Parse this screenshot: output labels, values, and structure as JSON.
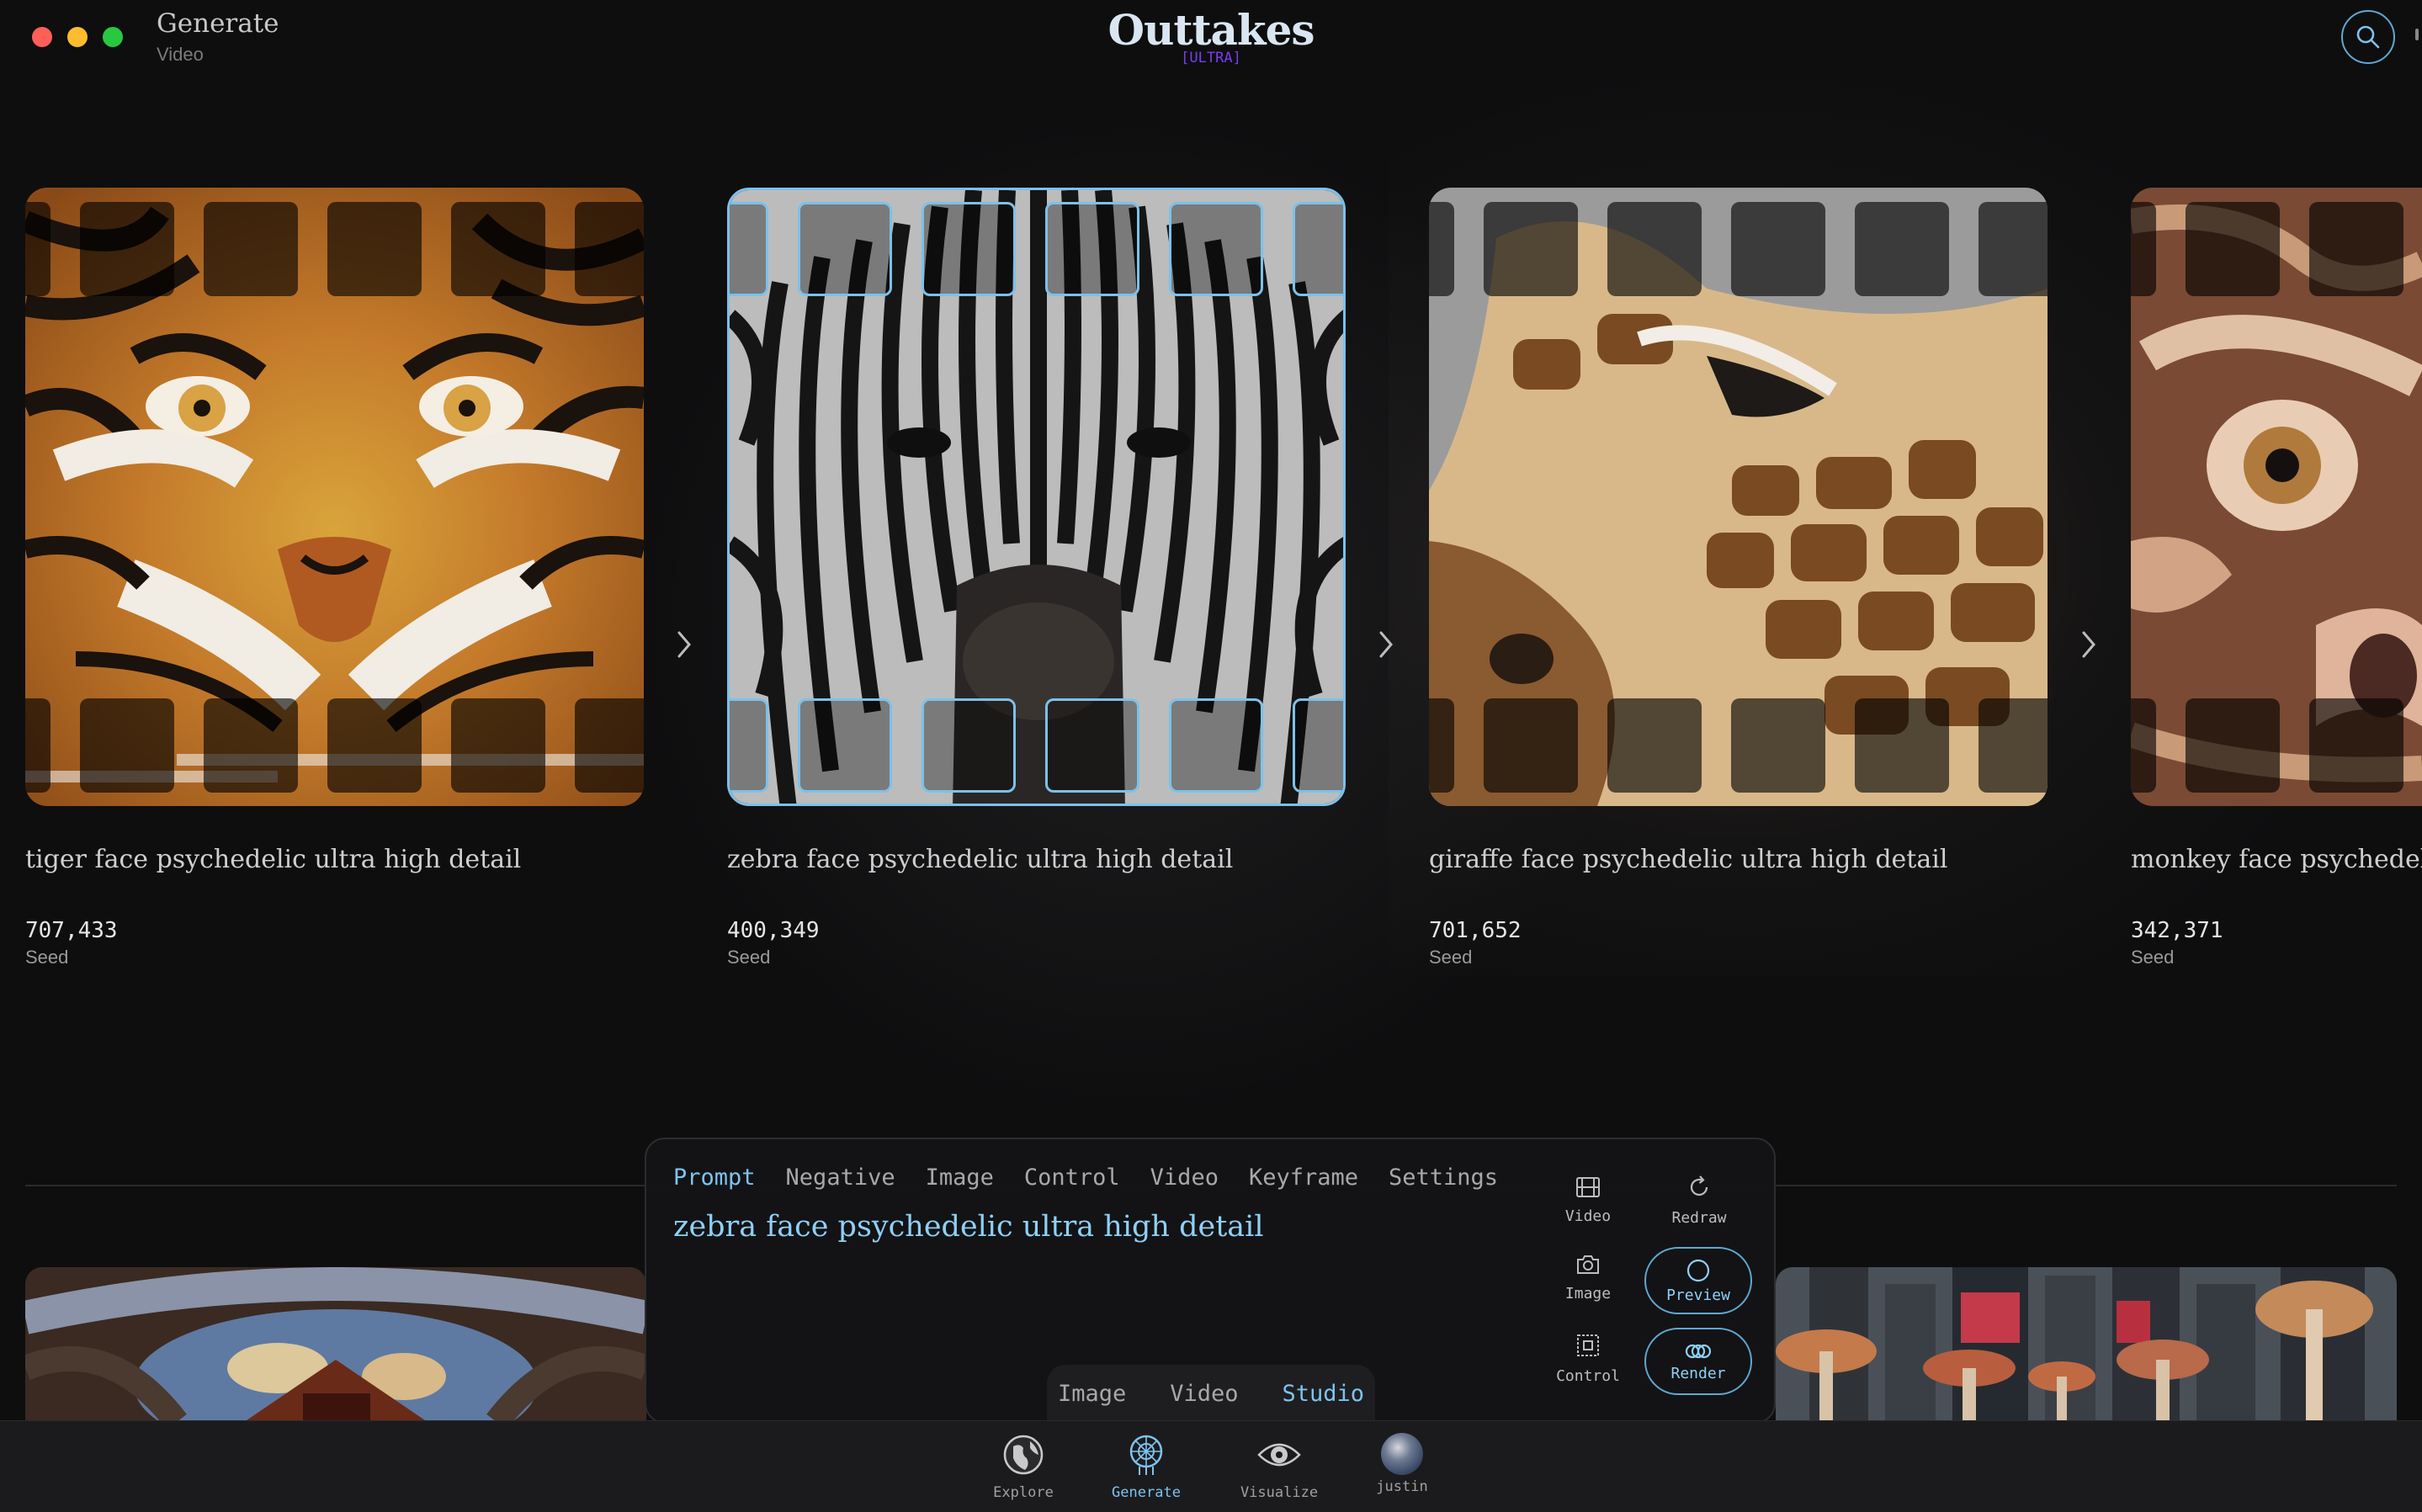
{
  "window": {
    "title": "Generate",
    "subtitle": "Video"
  },
  "brand": {
    "name": "Outtakes",
    "tier": "[ULTRA]",
    "accent": "#7ec3ef",
    "tier_color": "#7a3cf2"
  },
  "cards": [
    {
      "caption": "tiger face psychedelic ultra high detail",
      "seed": "707,433",
      "seed_label": "Seed",
      "selected": false
    },
    {
      "caption": "zebra face psychedelic ultra high detail",
      "seed": "400,349",
      "seed_label": "Seed",
      "selected": true
    },
    {
      "caption": "giraffe face psychedelic ultra high detail",
      "seed": "701,652",
      "seed_label": "Seed",
      "selected": false
    },
    {
      "caption": "monkey face psychedelic ultra high detail",
      "seed": "342,371",
      "seed_label": "Seed",
      "selected": false
    }
  ],
  "panel": {
    "tabs": [
      "Prompt",
      "Negative",
      "Image",
      "Control",
      "Video",
      "Keyframe",
      "Settings"
    ],
    "active_tab": "Prompt",
    "prompt": "zebra face psychedelic ultra high detail",
    "tools": {
      "video": "Video",
      "redraw": "Redraw",
      "image": "Image",
      "preview": "Preview",
      "control": "Control",
      "render": "Render"
    }
  },
  "mode_switch": {
    "items": [
      "Image",
      "Video",
      "Studio"
    ],
    "active": "Studio"
  },
  "dock": {
    "explore": "Explore",
    "generate": "Generate",
    "visualize": "Visualize",
    "user": "justin",
    "active": "Generate"
  },
  "icons": [
    "search-icon",
    "chevron-right-icon",
    "film-icon",
    "redraw-icon",
    "camera-icon",
    "preview-circle-icon",
    "control-icon",
    "render-icon",
    "globe-icon",
    "dreamcatcher-icon",
    "eye-icon"
  ]
}
